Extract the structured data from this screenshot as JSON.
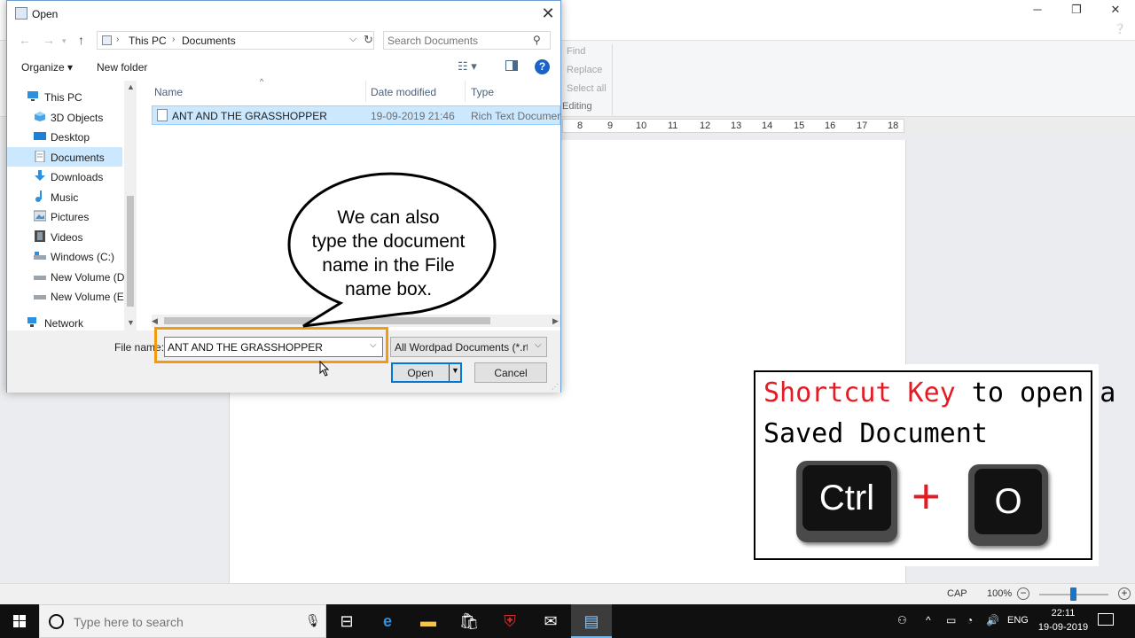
{
  "dialog": {
    "title": "Open",
    "close_glyph": "✕",
    "breadcrumb": [
      "This PC",
      "Documents"
    ],
    "search_placeholder": "Search Documents",
    "toolbar": {
      "organize": "Organize ▾",
      "new_folder": "New folder"
    },
    "nav_items": [
      {
        "label": "This PC",
        "icon": "computer-icon"
      },
      {
        "label": "3D Objects",
        "icon": "3d-objects-icon"
      },
      {
        "label": "Desktop",
        "icon": "desktop-icon"
      },
      {
        "label": "Documents",
        "icon": "documents-icon",
        "selected": true
      },
      {
        "label": "Downloads",
        "icon": "downloads-icon"
      },
      {
        "label": "Music",
        "icon": "music-icon"
      },
      {
        "label": "Pictures",
        "icon": "pictures-icon"
      },
      {
        "label": "Videos",
        "icon": "videos-icon"
      },
      {
        "label": "Windows (C:)",
        "icon": "drive-icon"
      },
      {
        "label": "New Volume (D:",
        "icon": "drive-icon"
      },
      {
        "label": "New Volume (E:)",
        "icon": "drive-icon"
      },
      {
        "label": "Network",
        "icon": "network-icon"
      }
    ],
    "columns": [
      "Name",
      "Date modified",
      "Type"
    ],
    "files": [
      {
        "name": "ANT AND THE GRASSHOPPER",
        "date": "19-09-2019 21:46",
        "type": "Rich Text Document"
      }
    ],
    "file_name_label": "File name:",
    "file_name_value": "ANT AND THE GRASSHOPPER",
    "file_filter": "All Wordpad Documents (*.rtf,",
    "open_label": "Open",
    "cancel_label": "Cancel"
  },
  "wordpad": {
    "editing_items": [
      "Find",
      "Replace",
      "Select all"
    ],
    "editing_group": "Editing",
    "ruler_numbers": [
      "8",
      "9",
      "10",
      "11",
      "12",
      "13",
      "14",
      "15",
      "16",
      "17",
      "18"
    ],
    "status": {
      "caps": "CAP",
      "zoom": "100%"
    }
  },
  "annotation": {
    "bubble_lines": [
      "We can also",
      "type the document",
      "name in the File",
      "name box."
    ]
  },
  "shortcut_card": {
    "highlight": "Shortcut Key",
    "rest_line1": " to open a",
    "line2": "Saved Document",
    "key1": "Ctrl",
    "plus": "+",
    "key2": "O",
    "accent_color": "#e51b24"
  },
  "taskbar": {
    "search_placeholder": "Type here to search",
    "lang": "ENG",
    "time": "22:11",
    "date": "19-09-2019"
  }
}
